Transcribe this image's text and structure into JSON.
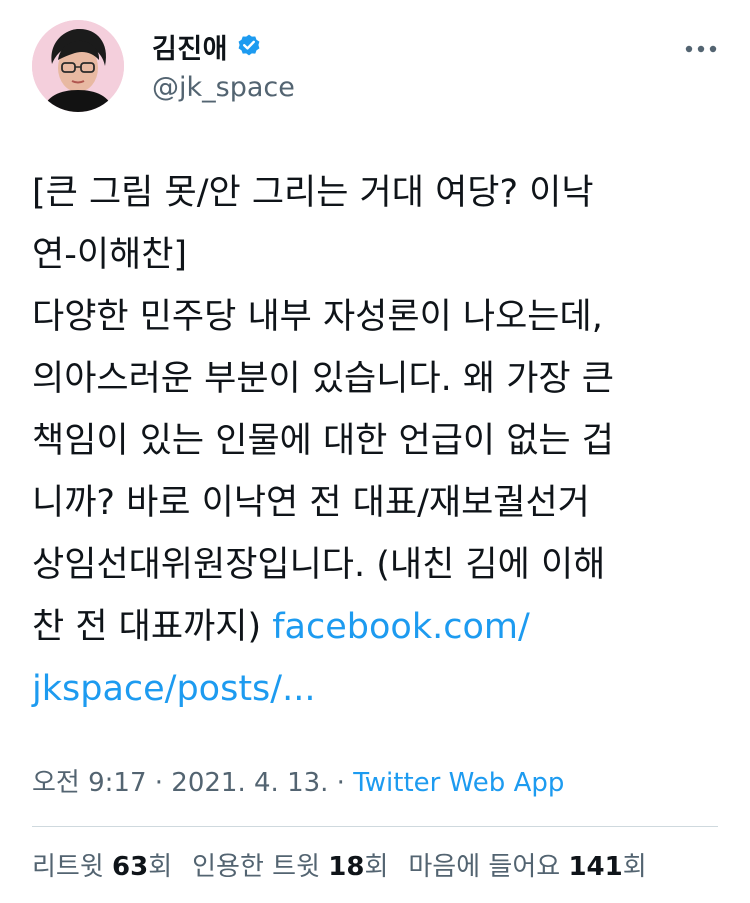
{
  "author": {
    "display_name": "김진애",
    "handle": "@jk_space",
    "verified_icon": "verified-badge-icon",
    "avatar_icon": "profile-photo"
  },
  "tweet": {
    "line1": "[큰 그림 못/안 그리는 거대 여당? 이낙",
    "line2": "연-이해찬]",
    "line3": "다양한 민주당 내부 자성론이 나오는데,",
    "line4": "의아스러운 부분이 있습니다. 왜 가장 큰",
    "line5": "책임이 있는 인물에 대한 언급이 없는 겁",
    "line6": "니까? 바로 이낙연 전 대표/재보궐선거",
    "line7": "상임선대위원장입니다. (내친 김에 이해",
    "line8_text": "찬 전 대표까지) ",
    "link_part1": "facebook.com/",
    "link_part2": "jkspace/posts/..."
  },
  "meta": {
    "time": "오전 9:17",
    "sep1": " · ",
    "date": "2021. 4. 13.",
    "sep2": " · ",
    "source": "Twitter Web App"
  },
  "stats": {
    "retweets_label": "리트윗 ",
    "retweets_count": "63",
    "retweets_unit": "회",
    "quotes_label": "인용한 트윗 ",
    "quotes_count": "18",
    "quotes_unit": "회",
    "likes_label": "마음에 들어요 ",
    "likes_count": "141",
    "likes_unit": "회"
  },
  "colors": {
    "link": "#1d9bf0",
    "secondary_text": "#536471",
    "primary_text": "#0f1419",
    "verified": "#1d9bf0"
  }
}
